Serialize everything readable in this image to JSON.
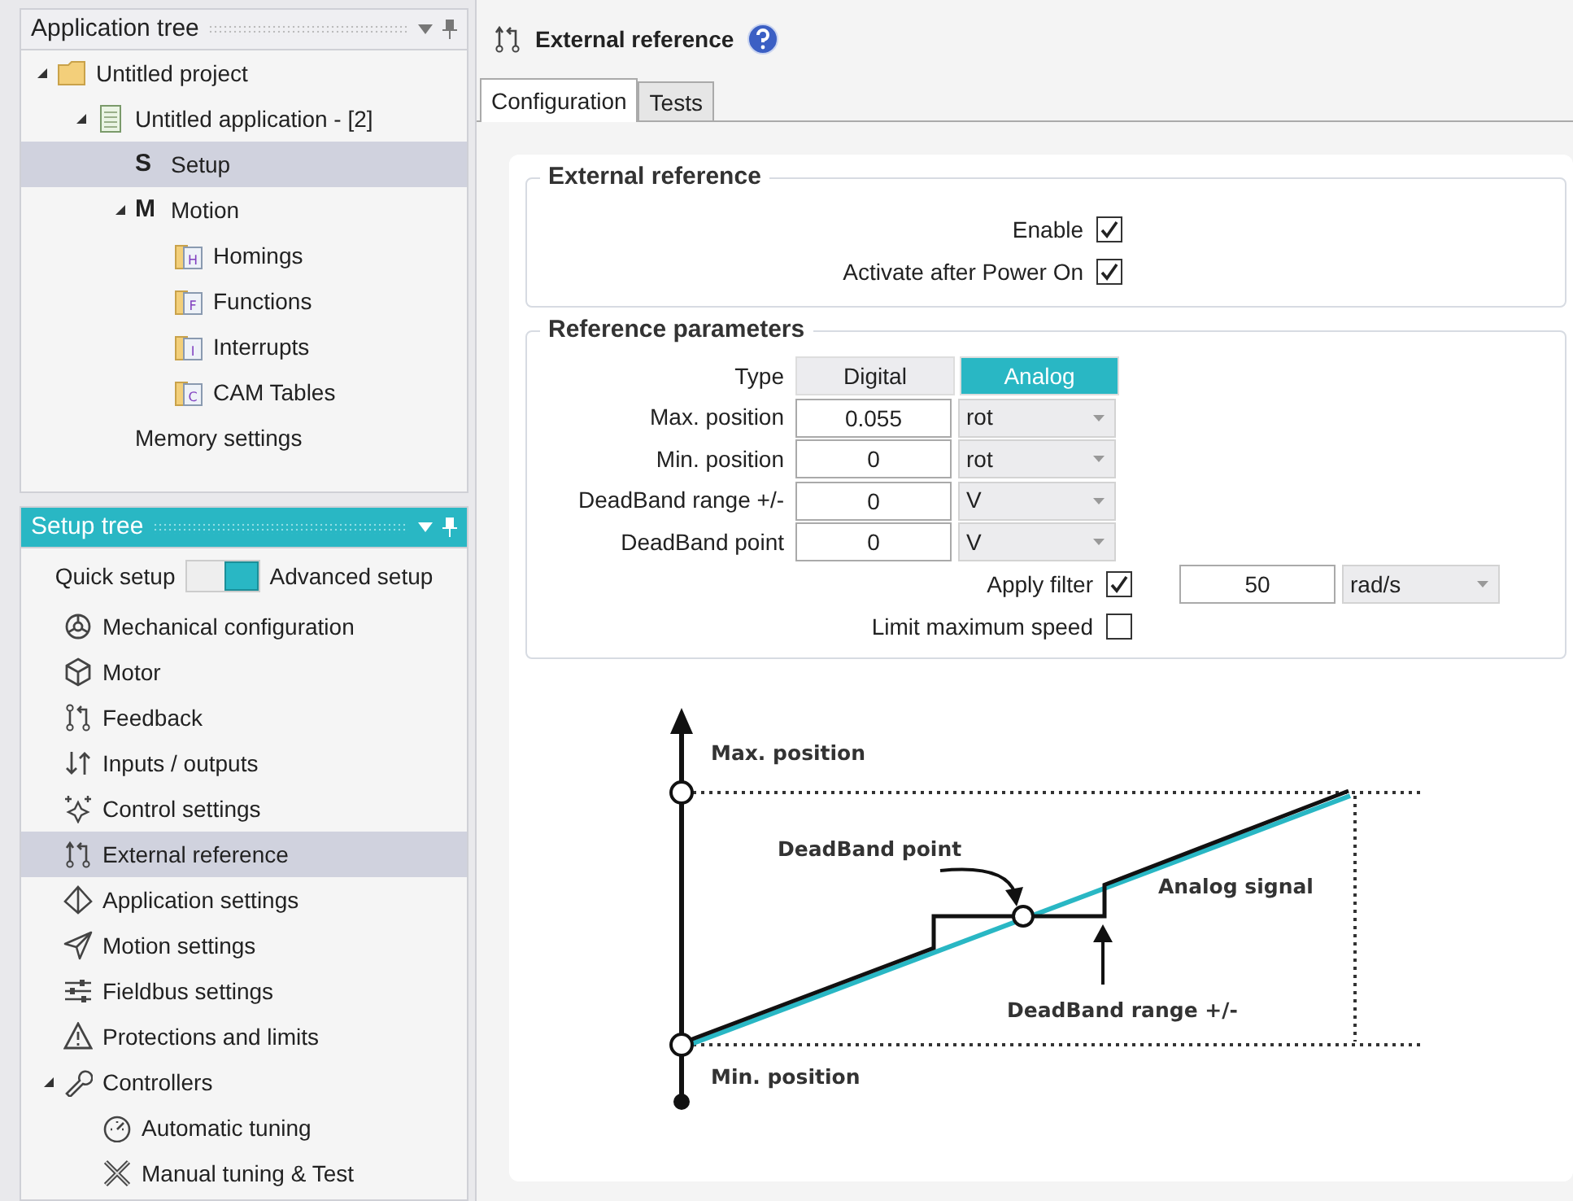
{
  "application_tree": {
    "title": "Application tree",
    "active": false,
    "items": [
      {
        "label": "Untitled project",
        "kind": "folder",
        "expanded": true,
        "selected": false,
        "children": [
          {
            "label": "Untitled application - [2]",
            "kind": "notebook",
            "expanded": true,
            "selected": false,
            "children": [
              {
                "label": "Setup",
                "glyph": "S",
                "selected": true
              },
              {
                "label": "Motion",
                "glyph": "M",
                "expanded": true,
                "selected": false,
                "children": [
                  {
                    "label": "Homings",
                    "kind": "folder-file",
                    "badge": "H",
                    "selected": false
                  },
                  {
                    "label": "Functions",
                    "kind": "folder-file",
                    "badge": "F",
                    "selected": false
                  },
                  {
                    "label": "Interrupts",
                    "kind": "folder-file",
                    "badge": "I",
                    "selected": false
                  },
                  {
                    "label": "CAM Tables",
                    "kind": "folder-file",
                    "badge": "C",
                    "selected": false
                  }
                ]
              },
              {
                "label": "Memory settings",
                "selected": false
              }
            ]
          }
        ]
      }
    ]
  },
  "setup_tree": {
    "title": "Setup tree",
    "active": true,
    "mode_switch": {
      "left_label": "Quick setup",
      "right_label": "Advanced setup",
      "on": true
    },
    "items": [
      {
        "label": "Mechanical configuration",
        "kind": "gear",
        "selected": false
      },
      {
        "label": "Motor",
        "kind": "cube",
        "selected": false
      },
      {
        "label": "Feedback",
        "kind": "loop",
        "selected": false
      },
      {
        "label": "Inputs / outputs",
        "kind": "updown",
        "selected": false
      },
      {
        "label": "Control settings",
        "kind": "sparkle",
        "selected": false
      },
      {
        "label": "External reference",
        "kind": "route",
        "selected": true
      },
      {
        "label": "Application settings",
        "kind": "pyramid",
        "selected": false
      },
      {
        "label": "Motion settings",
        "kind": "send",
        "selected": false
      },
      {
        "label": "Fieldbus settings",
        "kind": "sliders",
        "selected": false
      },
      {
        "label": "Protections and limits",
        "kind": "warning",
        "selected": false
      },
      {
        "label": "Controllers",
        "kind": "wrench",
        "expanded": true,
        "selected": false,
        "children": [
          {
            "label": "Automatic tuning",
            "kind": "gauge",
            "selected": false
          },
          {
            "label": "Manual tuning & Test",
            "kind": "tools",
            "selected": false
          }
        ]
      }
    ]
  },
  "page": {
    "title": "External reference",
    "tabs": [
      {
        "label": "Configuration",
        "selected": true
      },
      {
        "label": "Tests",
        "selected": false
      }
    ],
    "external_reference": {
      "title": "External reference",
      "checks": [
        {
          "label": "Enable",
          "checked": true
        },
        {
          "label": "Activate after Power On",
          "checked": true
        }
      ]
    },
    "reference_parameters": {
      "title": "Reference parameters",
      "type": {
        "label": "Type",
        "options": [
          {
            "label": "Digital",
            "selected": false
          },
          {
            "label": "Analog",
            "selected": true
          }
        ]
      },
      "fields": [
        {
          "label": "Max. position",
          "value": "0.055",
          "unit": "rot"
        },
        {
          "label": "Min. position",
          "value": "0",
          "unit": "rot"
        },
        {
          "label": "DeadBand range +/-",
          "value": "0",
          "unit": "V"
        },
        {
          "label": "DeadBand point",
          "value": "0",
          "unit": "V"
        }
      ],
      "apply_filter": {
        "label": "Apply filter",
        "checked": true,
        "value": "50",
        "unit": "rad/s"
      },
      "limit_speed": {
        "label": "Limit maximum speed",
        "checked": false
      }
    },
    "diagram": {
      "max_label": "Max. position",
      "min_label": "Min. position",
      "point_label": "DeadBand point",
      "signal_label": "Analog signal",
      "range_label": "DeadBand range +/-"
    }
  }
}
